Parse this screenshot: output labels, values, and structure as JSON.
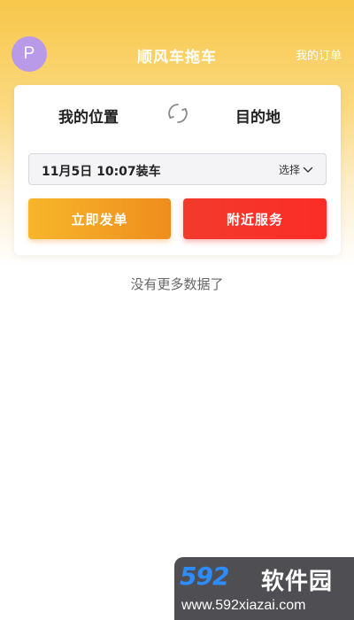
{
  "header": {
    "avatar_letter": "P",
    "title": "顺风车拖车",
    "orders_label": "我的订单"
  },
  "card": {
    "from_label": "我的位置",
    "to_label": "目的地",
    "swap_icon": "swap-refresh-icon",
    "time_value": "11月5日 10:07装车",
    "select_label": "选择",
    "order_button": "立即发单",
    "nearby_button": "附近服务"
  },
  "list": {
    "empty_text": "没有更多数据了"
  },
  "watermark": {
    "logo": "592",
    "name": "软件园",
    "url": "www.592xiazai.com"
  },
  "colors": {
    "header_yellow": "#f8c74a",
    "avatar_purple": "#b99ae9",
    "order_orange": "#ee8d1d",
    "nearby_red": "#f23a2c",
    "watermark_blue": "#2d8cff"
  }
}
